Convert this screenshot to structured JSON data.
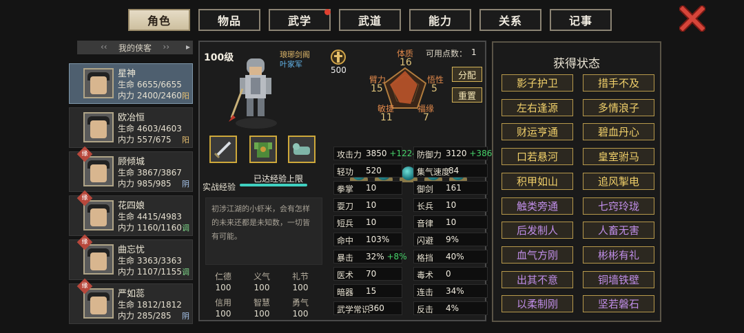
{
  "tabs": [
    {
      "label": "角色",
      "active": true
    },
    {
      "label": "物品",
      "active": false
    },
    {
      "label": "武学",
      "active": false,
      "dot": true
    },
    {
      "label": "武道",
      "active": false
    },
    {
      "label": "能力",
      "active": false
    },
    {
      "label": "关系",
      "active": false
    },
    {
      "label": "记事",
      "active": false
    }
  ],
  "list_header": "我的侠客",
  "characters": [
    {
      "name": "星神",
      "hp": "生命 6655/6655",
      "mp": "内力 2400/2460",
      "yy": "阳",
      "yy_color": "#e8c070",
      "selected": true,
      "badge": ""
    },
    {
      "name": "欧冶恒",
      "hp": "生命 4603/4603",
      "mp": "内力 557/675",
      "yy": "阳",
      "yy_color": "#e8c070",
      "selected": false,
      "badge": ""
    },
    {
      "name": "顾倾城",
      "hp": "生命 3867/3867",
      "mp": "内力 985/985",
      "yy": "阴",
      "yy_color": "#a9c8f0",
      "selected": false,
      "badge": "缘"
    },
    {
      "name": "花四娘",
      "hp": "生命 4415/4983",
      "mp": "内力 1160/1160",
      "yy": "调",
      "yy_color": "#7fd88a",
      "selected": false,
      "badge": "缘"
    },
    {
      "name": "曲忘忧",
      "hp": "生命 3363/3363",
      "mp": "内力 1107/1155",
      "yy": "调",
      "yy_color": "#7fd88a",
      "selected": false,
      "badge": "缘"
    },
    {
      "name": "严如蕊",
      "hp": "生命 1812/1812",
      "mp": "内力 285/285",
      "yy": "阴",
      "yy_color": "#a9c8f0",
      "selected": false,
      "badge": "缘"
    }
  ],
  "profile": {
    "level": "100级",
    "sect": "琅琊剑阁",
    "faction": "叶家军",
    "reputation": "500",
    "exp_label": "实战经验",
    "exp_status": "已达经验上限",
    "bio": "初涉江湖的小虾米，会有怎样的未来还都是未知数，一切皆有可能。"
  },
  "attributes": {
    "points_label": "可用点数：",
    "points": "1",
    "tizhi_label": "体质",
    "tizhi": "16",
    "bili_label": "臂力",
    "bili": "15",
    "wuxing_label": "悟性",
    "wuxing": "5",
    "minjie_label": "敏捷",
    "minjie": "11",
    "fuyuan_label": "福缘",
    "fuyuan": "7",
    "assign_label": "分配",
    "reset_label": "重置"
  },
  "virtues": [
    {
      "label": "仁德",
      "value": "100"
    },
    {
      "label": "义气",
      "value": "100"
    },
    {
      "label": "礼节",
      "value": "100"
    },
    {
      "label": "信用",
      "value": "100"
    },
    {
      "label": "智慧",
      "value": "100"
    },
    {
      "label": "勇气",
      "value": "100"
    }
  ],
  "stats": [
    {
      "label": "攻击力",
      "value": "3850",
      "bonus": "+1224"
    },
    {
      "label": "防御力",
      "value": "3120",
      "bonus": "+386"
    },
    {
      "label": "轻功",
      "value": "520",
      "bonus": ""
    },
    {
      "label": "集气速度",
      "value": "84",
      "bonus": ""
    },
    {
      "label": "拳掌",
      "value": "10",
      "bonus": ""
    },
    {
      "label": "御剑",
      "value": "161",
      "bonus": ""
    },
    {
      "label": "耍刀",
      "value": "10",
      "bonus": ""
    },
    {
      "label": "长兵",
      "value": "10",
      "bonus": ""
    },
    {
      "label": "短兵",
      "value": "10",
      "bonus": ""
    },
    {
      "label": "音律",
      "value": "10",
      "bonus": ""
    },
    {
      "label": "命中",
      "value": "103%",
      "bonus": ""
    },
    {
      "label": "闪避",
      "value": "9%",
      "bonus": ""
    },
    {
      "label": "暴击",
      "value": "32%",
      "bonus": "+8%"
    },
    {
      "label": "格挡",
      "value": "40%",
      "bonus": ""
    },
    {
      "label": "医术",
      "value": "70",
      "bonus": ""
    },
    {
      "label": "毒术",
      "value": "0",
      "bonus": ""
    },
    {
      "label": "暗器",
      "value": "15",
      "bonus": ""
    },
    {
      "label": "连击",
      "value": "34%",
      "bonus": ""
    },
    {
      "label": "武学常识",
      "value": "360",
      "bonus": ""
    },
    {
      "label": "反击",
      "value": "4%",
      "bonus": ""
    }
  ],
  "status_title": "获得状态",
  "statuses": [
    {
      "label": "影子护卫",
      "color": "gold"
    },
    {
      "label": "措手不及",
      "color": "gold"
    },
    {
      "label": "左右逢源",
      "color": "gold"
    },
    {
      "label": "多情浪子",
      "color": "gold"
    },
    {
      "label": "财运亨通",
      "color": "gold"
    },
    {
      "label": "碧血丹心",
      "color": "gold"
    },
    {
      "label": "口若悬河",
      "color": "gold"
    },
    {
      "label": "皇室驸马",
      "color": "gold"
    },
    {
      "label": "积甲如山",
      "color": "gold"
    },
    {
      "label": "追风掣电",
      "color": "gold"
    },
    {
      "label": "触类旁通",
      "color": "purple"
    },
    {
      "label": "七窍玲珑",
      "color": "purple"
    },
    {
      "label": "后发制人",
      "color": "purple"
    },
    {
      "label": "人畜无害",
      "color": "purple"
    },
    {
      "label": "血气方刚",
      "color": "purple"
    },
    {
      "label": "彬彬有礼",
      "color": "purple"
    },
    {
      "label": "出其不意",
      "color": "purple"
    },
    {
      "label": "铜墙铁壁",
      "color": "purple"
    },
    {
      "label": "以柔制刚",
      "color": "purple"
    },
    {
      "label": "坚若磐石",
      "color": "purple"
    }
  ]
}
